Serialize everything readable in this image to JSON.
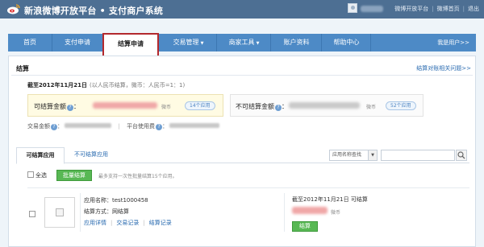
{
  "header": {
    "site_title": "新浪微博开放平台 • 支付商户系统",
    "links": [
      "微博开放平台",
      "微博首页",
      "退出"
    ]
  },
  "nav": {
    "items": [
      {
        "label": "首页"
      },
      {
        "label": "支付申请"
      },
      {
        "label": "结算申请",
        "active": true
      },
      {
        "label": "交易管理",
        "dropdown": true
      },
      {
        "label": "商家工具",
        "dropdown": true
      },
      {
        "label": "账户资料"
      },
      {
        "label": "帮助中心"
      }
    ],
    "right_label": "我是用户>>"
  },
  "settlement": {
    "title": "结算",
    "faq_link": "结算对账相关问题>>",
    "as_of": "截至2012年11月21日",
    "as_of_note": "(以人民币结算，微币：人民币=1：1)",
    "settleable_label": "可结算金额",
    "settleable_unit": "微币",
    "settleable_apps": "14个应用",
    "nonsettleable_label": "不可结算金额",
    "nonsettleable_unit": "微币",
    "nonsettleable_apps": "52个应用",
    "trade_amount_label": "交易金额",
    "platform_fee_label": "平台使用费"
  },
  "tabs": {
    "active": "可结算应用",
    "inactive": "不可结算应用",
    "select_value": "应用名称查找"
  },
  "batch": {
    "select_all": "全选",
    "button": "批量结算",
    "note": "最多支持一次性批量结算15个应用。"
  },
  "app_row": {
    "name_label": "应用名称",
    "name_value": "test1000458",
    "method_label": "结算方式",
    "method_value": "网结算",
    "links": [
      "应用详情",
      "交易记录",
      "结算记录"
    ],
    "as_of": "截至2012年11月21日 可结算",
    "unit": "微币",
    "settle_button": "结算"
  },
  "colors": {
    "topbar": "#4d6f93",
    "nav": "#4d8ac6",
    "active_tab_border": "#b3282d",
    "primary_button": "#58b854",
    "link": "#2a6bb0"
  }
}
